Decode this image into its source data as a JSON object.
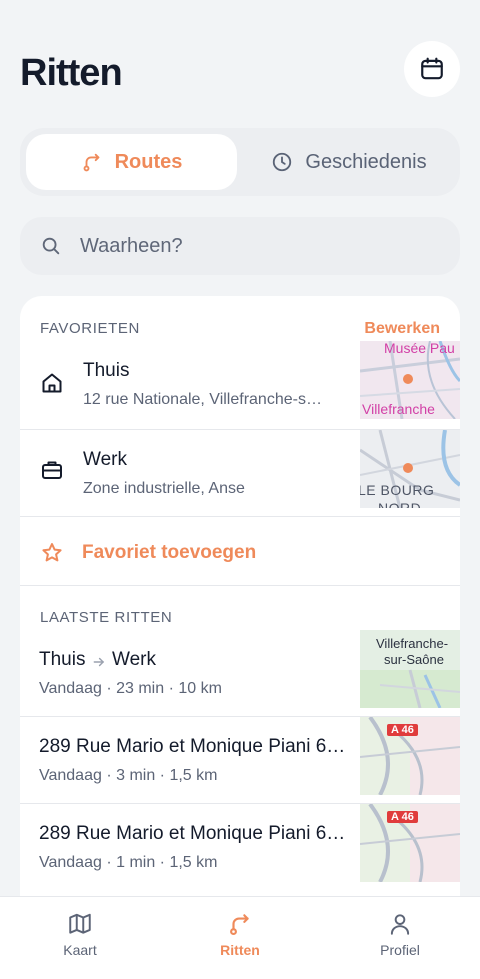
{
  "header": {
    "title": "Ritten",
    "calendar_icon": "calendar-icon"
  },
  "tabs": {
    "routes_label": "Routes",
    "history_label": "Geschiedenis"
  },
  "search": {
    "placeholder": "Waarheen?"
  },
  "favorites": {
    "heading": "FAVORIETEN",
    "edit_label": "Bewerken",
    "items": [
      {
        "name": "Thuis",
        "address": "12 rue Nationale, Villefranche-s…",
        "icon": "home-icon",
        "map_labels": [
          "Musée Pau",
          "Villefranche"
        ]
      },
      {
        "name": "Werk",
        "address": "Zone industrielle, Anse",
        "icon": "briefcase-icon",
        "map_labels": [
          "LE BOURG",
          "NORD"
        ]
      }
    ],
    "add_label": "Favoriet toevoegen"
  },
  "recent": {
    "heading": "LAATSTE RITTEN",
    "items": [
      {
        "from": "Thuis",
        "to": "Werk",
        "meta": "Vandaag · 23 min · 10 km",
        "map_labels": [
          "Villefranche-",
          "sur-Saône"
        ]
      },
      {
        "title": "289 Rue Mario et Monique Piani 6…",
        "meta": "Vandaag · 3 min · 1,5 km",
        "map_labels": [
          "A 46"
        ]
      },
      {
        "title": "289 Rue Mario et Monique Piani 6…",
        "meta": "Vandaag · 1 min · 1,5 km",
        "map_labels": [
          "A 46"
        ]
      }
    ]
  },
  "nav": {
    "map_label": "Kaart",
    "rides_label": "Ritten",
    "profile_label": "Profiel",
    "active": "Ritten"
  },
  "colors": {
    "accent": "#ef8a5a",
    "background": "#f2f4f6",
    "text": "#141b2b",
    "muted": "#5c6476"
  }
}
